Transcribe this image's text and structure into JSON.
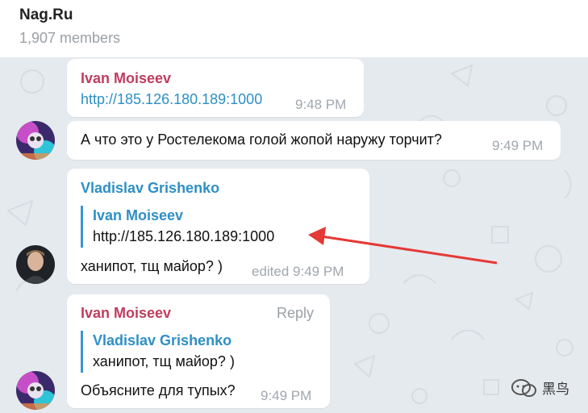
{
  "header": {
    "title": "Nag.Ru",
    "members": "1,907 members"
  },
  "messages": [
    {
      "sender": "Ivan Moiseev",
      "link": "http://185.126.180.189:1000",
      "time": "9:48 PM"
    },
    {
      "text": "А что это у Ростелекома голой жопой наружу торчит?",
      "time": "9:49 PM"
    },
    {
      "sender": "Vladislav Grishenko",
      "quote_sender": "Ivan Moiseev",
      "quote_text": "http://185.126.180.189:1000",
      "text": "ханипот, тщ майор? )",
      "time": "edited 9:49 PM"
    },
    {
      "sender": "Ivan Moiseev",
      "reply_label": "Reply",
      "quote_sender": "Vladislav Grishenko",
      "quote_text": "ханипот, тщ майор? )",
      "text": "Объясните для тупых?",
      "time": "9:49 PM"
    }
  ],
  "watermark": "黑鸟",
  "colors": {
    "chat_background": "#e5eaef",
    "sender_red": "#c03d5f",
    "sender_blue": "#2e8fc5",
    "annotation_arrow": "#e53935"
  }
}
